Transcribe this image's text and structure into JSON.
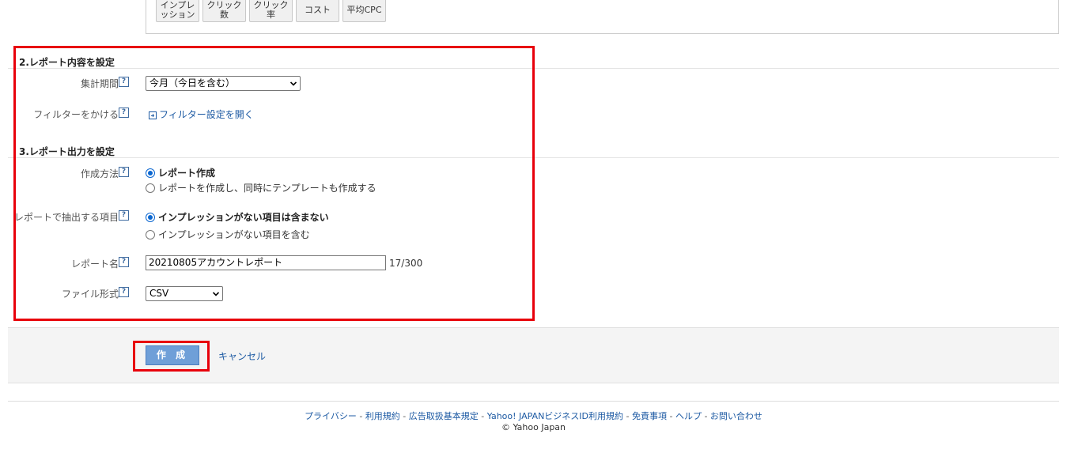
{
  "columns": [
    "インプレ\nッション",
    "クリック\n数",
    "クリック\n率",
    "コスト",
    "平均CPC"
  ],
  "section2": {
    "title": "2.レポート内容を設定",
    "period_label": "集計期間",
    "period_value": "今月（今日を含む）",
    "filter_label": "フィルターをかける",
    "filter_link": "フィルター設定を開く"
  },
  "section3": {
    "title": "3.レポート出力を設定",
    "method_label": "作成方法",
    "method_options": [
      "レポート作成",
      "レポートを作成し、同時にテンプレートも作成する"
    ],
    "extract_label": "レポートで抽出する項目",
    "extract_options": [
      "インプレッションがない項目は含まない",
      "インプレッションがない項目を含む"
    ],
    "name_label": "レポート名",
    "name_value": "20210805アカウントレポート",
    "name_counter": "17/300",
    "format_label": "ファイル形式",
    "format_value": "CSV"
  },
  "help_mark": "?",
  "actions": {
    "create_label": "作 成",
    "cancel_label": "キャンセル"
  },
  "footer": {
    "links": [
      "プライバシー",
      "利用規約",
      "広告取扱基本規定",
      "Yahoo! JAPANビジネスID利用規約",
      "免責事項",
      "ヘルプ",
      "お問い合わせ"
    ],
    "separator": " - ",
    "copyright": "© Yahoo Japan"
  },
  "colors": {
    "highlight": "#e8000b",
    "link": "#1d5aa3",
    "button": "#6f9fd8"
  }
}
